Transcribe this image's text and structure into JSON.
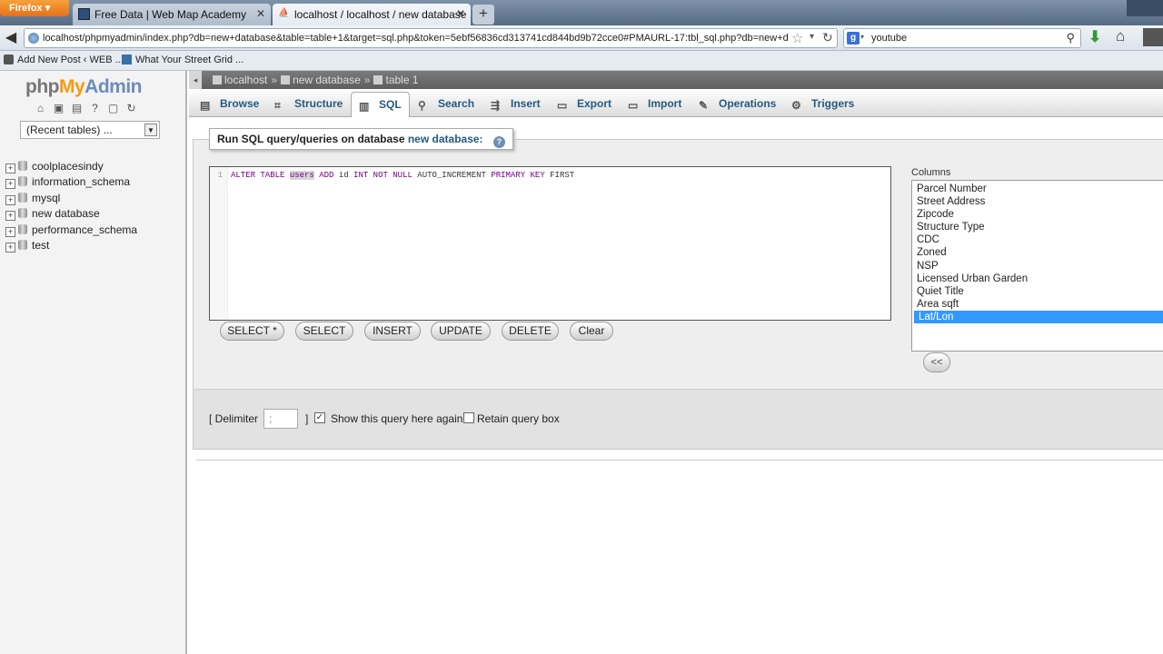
{
  "browser": {
    "app_button": "Firefox",
    "tabs": [
      {
        "title": "Free Data | Web Map Academy",
        "active": false
      },
      {
        "title": "localhost / localhost / new database ...",
        "active": true
      }
    ],
    "new_tab": "+",
    "url": "localhost/phpmyadmin/index.php?db=new+database&table=table+1&target=sql.php&token=5ebf56836cd313741cd844bd9b72cce0#PMAURL-17:tbl_sql.php?db=new+databa",
    "search_value": "youtube",
    "search_engine": "g",
    "bookmarks": [
      {
        "label": "Add New Post ‹ WEB ..."
      },
      {
        "label": "What Your Street Grid ..."
      }
    ]
  },
  "sidebar": {
    "logo_php": "php",
    "logo_my": "My",
    "logo_admin": "Admin",
    "recent_tables": "(Recent tables) ...",
    "databases": [
      {
        "name": "coolplacesindy"
      },
      {
        "name": "information_schema"
      },
      {
        "name": "mysql"
      },
      {
        "name": "new database"
      },
      {
        "name": "performance_schema"
      },
      {
        "name": "test"
      }
    ]
  },
  "breadcrumb": {
    "server": "localhost",
    "database": "new database",
    "table": "table 1"
  },
  "tabs": [
    {
      "label": "Browse",
      "icon": "browse-icon"
    },
    {
      "label": "Structure",
      "icon": "structure-icon"
    },
    {
      "label": "SQL",
      "icon": "sql-icon",
      "active": true
    },
    {
      "label": "Search",
      "icon": "search-icon"
    },
    {
      "label": "Insert",
      "icon": "insert-icon"
    },
    {
      "label": "Export",
      "icon": "export-icon"
    },
    {
      "label": "Import",
      "icon": "import-icon"
    },
    {
      "label": "Operations",
      "icon": "wrench-icon"
    },
    {
      "label": "Triggers",
      "icon": "triggers-icon"
    }
  ],
  "sql_panel": {
    "legend_prefix": "Run SQL query/queries on database",
    "legend_db": "new database:",
    "line_number": "1",
    "query": {
      "t1": "ALTER TABLE",
      "t2": "users",
      "t3": "ADD",
      "t4": "id",
      "t5": "INT NOT NULL",
      "t6": "AUTO_INCREMENT",
      "t7": "PRIMARY KEY",
      "t8": "FIRST"
    },
    "buttons": {
      "select_star": "SELECT *",
      "select": "SELECT",
      "insert": "INSERT",
      "update": "UPDATE",
      "delete": "DELETE",
      "clear": "Clear"
    },
    "columns_label": "Columns",
    "columns": [
      "Parcel Number",
      "Street Address",
      "Zipcode",
      "Structure Type",
      "CDC",
      "Zoned",
      "NSP",
      "Licensed Urban Garden",
      "Quiet Title",
      "Area sqft",
      "Lat/Lon"
    ],
    "selected_column": "Lat/Lon",
    "insert_button": "<<"
  },
  "options": {
    "delimiter_label": "[ Delimiter",
    "delimiter_value": ";",
    "delimiter_close": "]",
    "show_again_label": "Show this query here again",
    "show_again_checked": true,
    "retain_label": "Retain query box",
    "retain_checked": false
  },
  "colors": {
    "link": "#235a81",
    "logo_orange": "#f39b12",
    "selection": "#3399ff",
    "sql_keyword": "#770088"
  }
}
